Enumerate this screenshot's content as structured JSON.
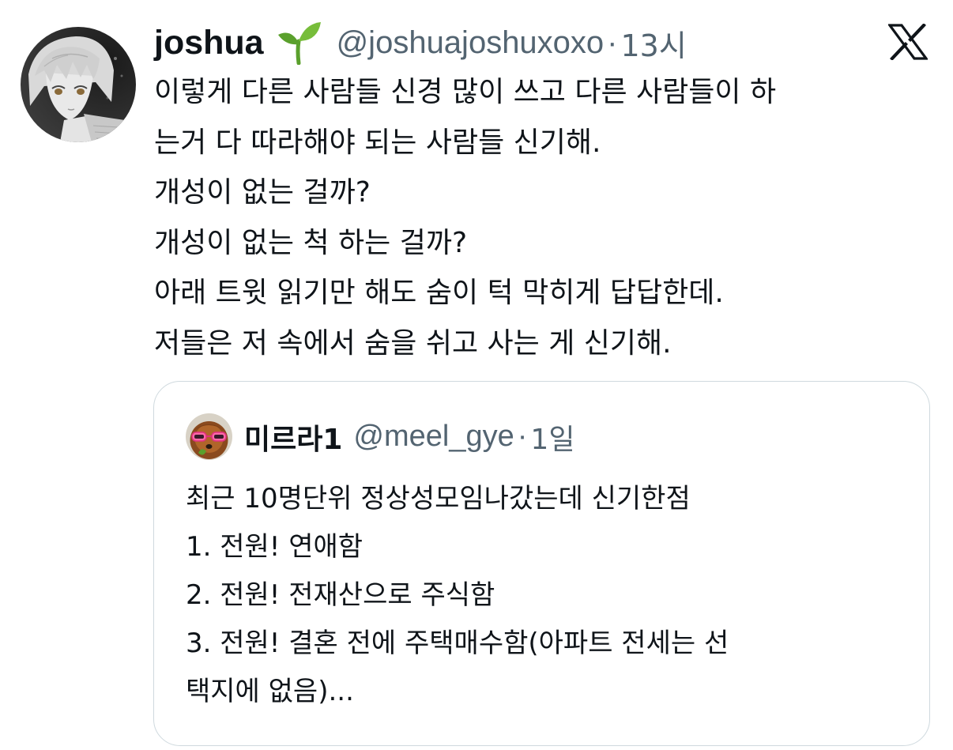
{
  "tweet": {
    "author": {
      "display_name": "joshua",
      "emoji_icon": "sprout-icon",
      "handle": "@joshuajoshuxoxo",
      "separator": "·",
      "time": "13시"
    },
    "body_lines": [
      "이렇게 다른 사람들 신경 많이 쓰고 다른 사람들이 하",
      "는거 다 따라해야 되는 사람들 신기해.",
      "개성이 없는 걸까?",
      "개성이 없는 척 하는 걸까?",
      "아래 트윗 읽기만 해도 숨이 턱 막히게 답답한데.",
      "저들은 저 속에서 숨을 쉬고 사는 게 신기해."
    ],
    "brand_icon": "x-logo-icon"
  },
  "quoted_tweet": {
    "author": {
      "display_name": "미르라1",
      "handle": "@meel_gye",
      "separator": "·",
      "time": "1일"
    },
    "body_lines": [
      "최근 10명단위 정상성모임나갔는데 신기한점",
      "1. 전원! 연애함",
      "2. 전원! 전재산으로 주식함",
      "3. 전원! 결혼 전에 주택매수함(아파트 전세는 선",
      "택지에 없음)..."
    ]
  },
  "colors": {
    "text_primary": "#0f1419",
    "text_secondary": "#536471",
    "border": "#cfd9de",
    "sprout_green": "#5aa02c"
  }
}
